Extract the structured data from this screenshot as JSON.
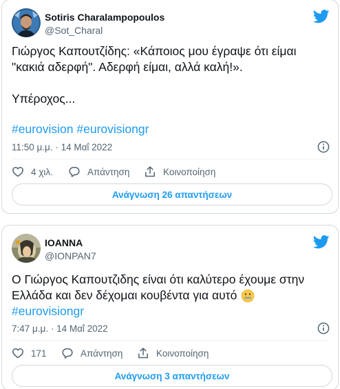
{
  "colors": {
    "link": "#1d9bf0",
    "text": "#0f1419",
    "muted": "#536471",
    "border": "#cfd9de"
  },
  "tweets": [
    {
      "author_name": "Sotiris Charalampopoulos",
      "author_handle": "@Sot_Charal",
      "text_line1": "Γιώργος Καπουτζίδης: «Κάποιος μου έγραψε ότι είμαι",
      "text_line2": "\"κακιά αδερφή\". Αδερφή είμαι, αλλά καλή!».",
      "text_line3": "Υπέροχος...",
      "hashtags": [
        "#eurovision",
        "#eurovisiongr"
      ],
      "timestamp": "11:50 μ.μ. · 14 Μαΐ 2022",
      "likes": "4 χιλ.",
      "reply_label": "Απάντηση",
      "share_label": "Κοινοποίηση",
      "replies_button": "Ανάγνωση 26 απαντήσεων"
    },
    {
      "author_name": "IOANNA",
      "author_handle": "@IONPAN7",
      "text_line1": "Ο Γιώργος Καπουτζιδης είναι ότι καλύτερο έχουμε στην",
      "text_line2": "Ελλάδα και δεν δέχομαι κουβέντα για αυτό",
      "hashtag": "#eurovisiongr",
      "timestamp": "7:47 μ.μ. · 14 Μαΐ 2022",
      "likes": "171",
      "reply_label": "Απάντηση",
      "share_label": "Κοινοποίηση",
      "replies_button": "Ανάγνωση 3 απαντήσεων"
    }
  ],
  "icons": {
    "bird": "twitter-bird-icon",
    "info": "info-icon",
    "like": "heart-icon",
    "reply": "comment-icon",
    "share": "share-icon",
    "emoji": "zipper-mouth-face-emoji"
  }
}
